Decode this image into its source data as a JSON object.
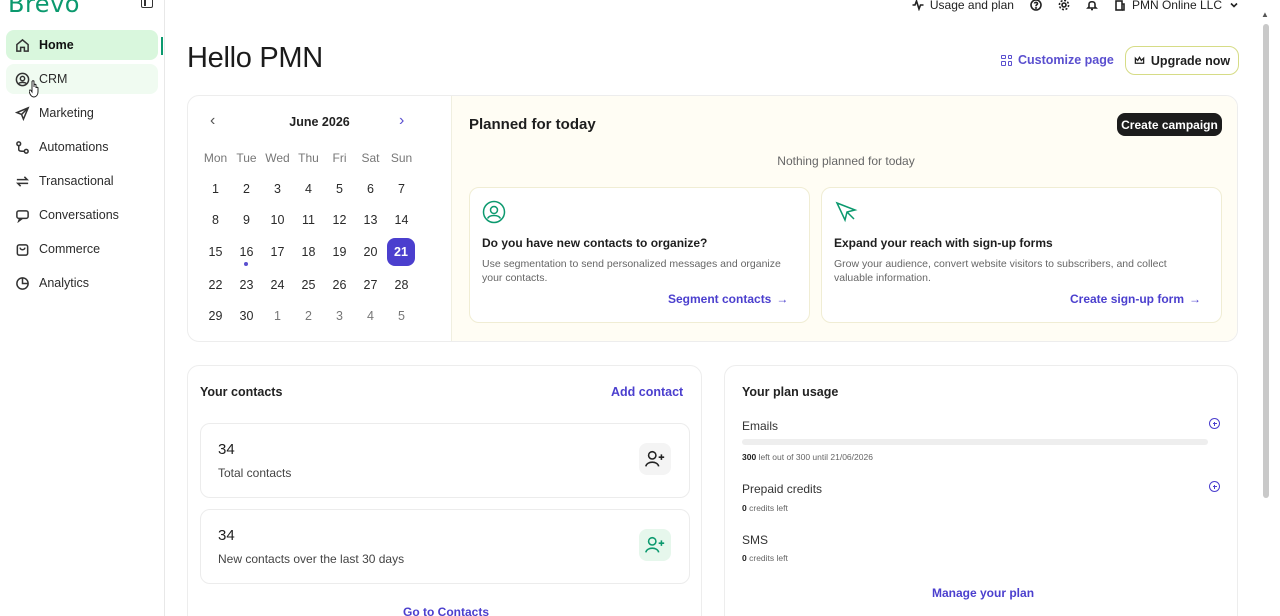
{
  "brand": {
    "logo_text": "Brevo",
    "accent": "#0b996e",
    "primary": "#4b3fce"
  },
  "sidebar": {
    "items": [
      {
        "label": "Home",
        "icon": "home-icon",
        "state": "active"
      },
      {
        "label": "CRM",
        "icon": "contact-circle-icon",
        "state": "hover"
      },
      {
        "label": "Marketing",
        "icon": "paper-plane-icon",
        "state": ""
      },
      {
        "label": "Automations",
        "icon": "automation-flow-icon",
        "state": ""
      },
      {
        "label": "Transactional",
        "icon": "transfer-arrows-icon",
        "state": ""
      },
      {
        "label": "Conversations",
        "icon": "chat-bubble-icon",
        "state": ""
      },
      {
        "label": "Commerce",
        "icon": "shopping-bag-icon",
        "state": ""
      },
      {
        "label": "Analytics",
        "icon": "pie-chart-icon",
        "state": ""
      }
    ]
  },
  "topbar": {
    "usage_label": "Usage and plan",
    "account_label": "PMN Online LLC"
  },
  "header": {
    "title": "Hello PMN",
    "customize_label": "Customize page",
    "upgrade_label": "Upgrade now"
  },
  "calendar": {
    "month_label": "June 2026",
    "weekdays": [
      "Mon",
      "Tue",
      "Wed",
      "Thu",
      "Fri",
      "Sat",
      "Sun"
    ],
    "weeks": [
      [
        "1",
        "2",
        "3",
        "4",
        "5",
        "6",
        "7"
      ],
      [
        "8",
        "9",
        "10",
        "11",
        "12",
        "13",
        "14"
      ],
      [
        "15",
        "16",
        "17",
        "18",
        "19",
        "20",
        "21"
      ],
      [
        "22",
        "23",
        "24",
        "25",
        "26",
        "27",
        "28"
      ],
      [
        "29",
        "30",
        "1",
        "2",
        "3",
        "4",
        "5"
      ]
    ],
    "today": "21",
    "marked_day": "16"
  },
  "planned": {
    "title": "Planned for today",
    "create_label": "Create campaign",
    "empty_text": "Nothing planned for today",
    "cards": [
      {
        "title": "Do you have new contacts to organize?",
        "text": "Use segmentation to send personalized messages and organize your contacts.",
        "link": "Segment contacts"
      },
      {
        "title": "Expand your reach with sign-up forms",
        "text": "Grow your audience, convert website visitors to subscribers, and collect valuable information.",
        "link": "Create sign-up form"
      }
    ]
  },
  "contacts": {
    "title": "Your contacts",
    "add_label": "Add contact",
    "total_value": "34",
    "total_label": "Total contacts",
    "new_value": "34",
    "new_label": "New contacts over the last 30 days",
    "goto_label": "Go to Contacts"
  },
  "plan": {
    "title": "Your plan usage",
    "emails_label": "Emails",
    "emails_left": "300",
    "emails_suffix": "left out of 300 until 21/06/2026",
    "emails_used_fraction": 0.0,
    "prepaid_label": "Prepaid credits",
    "prepaid_value": "0",
    "prepaid_suffix": "credits left",
    "sms_label": "SMS",
    "sms_value": "0",
    "sms_suffix": "credits left",
    "manage_label": "Manage your plan"
  }
}
